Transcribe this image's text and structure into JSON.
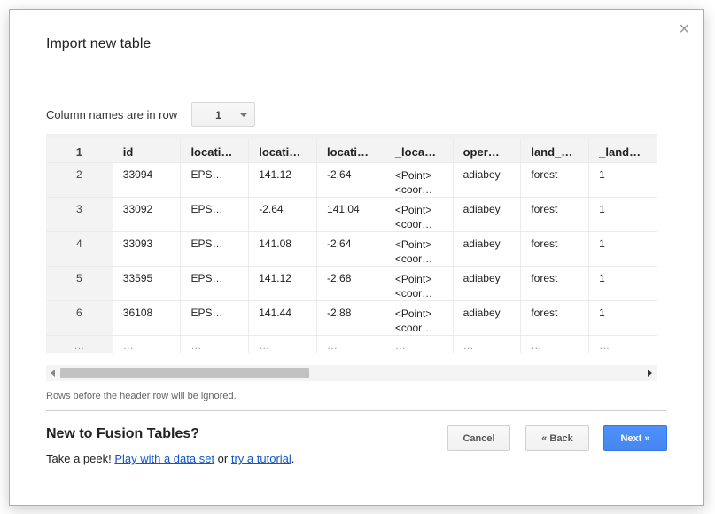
{
  "dialog": {
    "title": "Import new table",
    "close_glyph": "×"
  },
  "column_row": {
    "label": "Column names are in row",
    "selected": "1"
  },
  "table": {
    "header": [
      "1",
      "id",
      "locati…",
      "locati…",
      "locati…",
      "_loca…",
      "oper…",
      "land_…",
      "_land…"
    ],
    "rows": [
      {
        "num": "2",
        "cells": [
          "33094",
          "EPS…",
          "141.12",
          "-2.64",
          [
            "<Point>",
            "<coor…"
          ],
          "adiabey",
          "forest",
          "1"
        ]
      },
      {
        "num": "3",
        "cells": [
          "33092",
          "EPS…",
          "-2.64",
          "141.04",
          [
            "<Point>",
            "<coor…"
          ],
          "adiabey",
          "forest",
          "1"
        ]
      },
      {
        "num": "4",
        "cells": [
          "33093",
          "EPS…",
          "141.08",
          "-2.64",
          [
            "<Point>",
            "<coor…"
          ],
          "adiabey",
          "forest",
          "1"
        ]
      },
      {
        "num": "5",
        "cells": [
          "33595",
          "EPS…",
          "141.12",
          "-2.68",
          [
            "<Point>",
            "<coor…"
          ],
          "adiabey",
          "forest",
          "1"
        ]
      },
      {
        "num": "6",
        "cells": [
          "36108",
          "EPS…",
          "141.44",
          "-2.88",
          [
            "<Point>",
            "<coor…"
          ],
          "adiabey",
          "forest",
          "1"
        ]
      }
    ],
    "ellipsis": "…"
  },
  "hint": "Rows before the header row will be ignored.",
  "footer": {
    "title": "New to Fusion Tables?",
    "peek_prefix": "Take a peek! ",
    "link1": "Play with a data set",
    "between": " or ",
    "link2": "try a tutorial",
    "suffix": "."
  },
  "buttons": {
    "cancel": "Cancel",
    "back": "« Back",
    "next": "Next »"
  }
}
